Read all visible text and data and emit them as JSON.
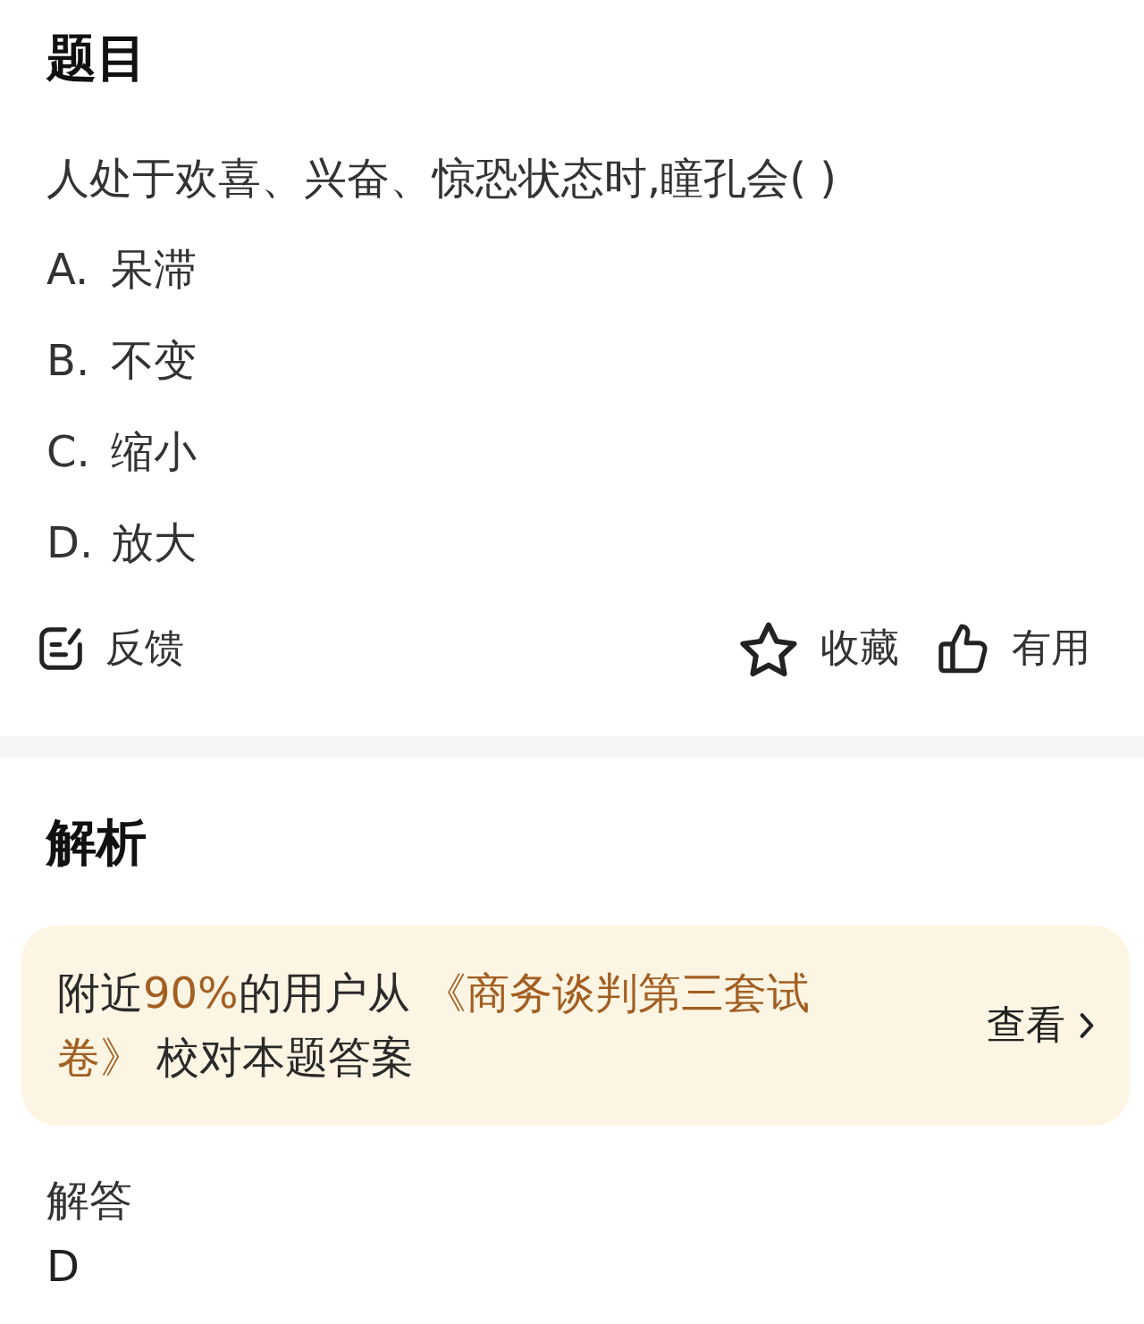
{
  "question_section": {
    "title": "题目",
    "question": "人处于欢喜、兴奋、惊恐状态时,瞳孔会( )",
    "options": [
      {
        "letter": "A.",
        "text": "呆滞"
      },
      {
        "letter": "B.",
        "text": "不变"
      },
      {
        "letter": "C.",
        "text": "缩小"
      },
      {
        "letter": "D.",
        "text": "放大"
      }
    ]
  },
  "actions": {
    "left": [
      {
        "kind": "feedback",
        "label": "反馈"
      }
    ],
    "right": [
      {
        "kind": "favorite",
        "label": "收藏"
      },
      {
        "kind": "useful",
        "label": "有用"
      }
    ]
  },
  "analysis_section": {
    "title": "解析",
    "banner": {
      "segments": [
        {
          "text": "附近",
          "highlight": false
        },
        {
          "text": "90%",
          "highlight": true
        },
        {
          "text": "的用户从 ",
          "highlight": false
        },
        {
          "text": "《商务谈判第三套试卷》",
          "highlight": true
        },
        {
          "text": " 校对本题答案",
          "highlight": false
        }
      ],
      "link": "查看"
    },
    "answer_label": "解答",
    "answer": "D"
  }
}
